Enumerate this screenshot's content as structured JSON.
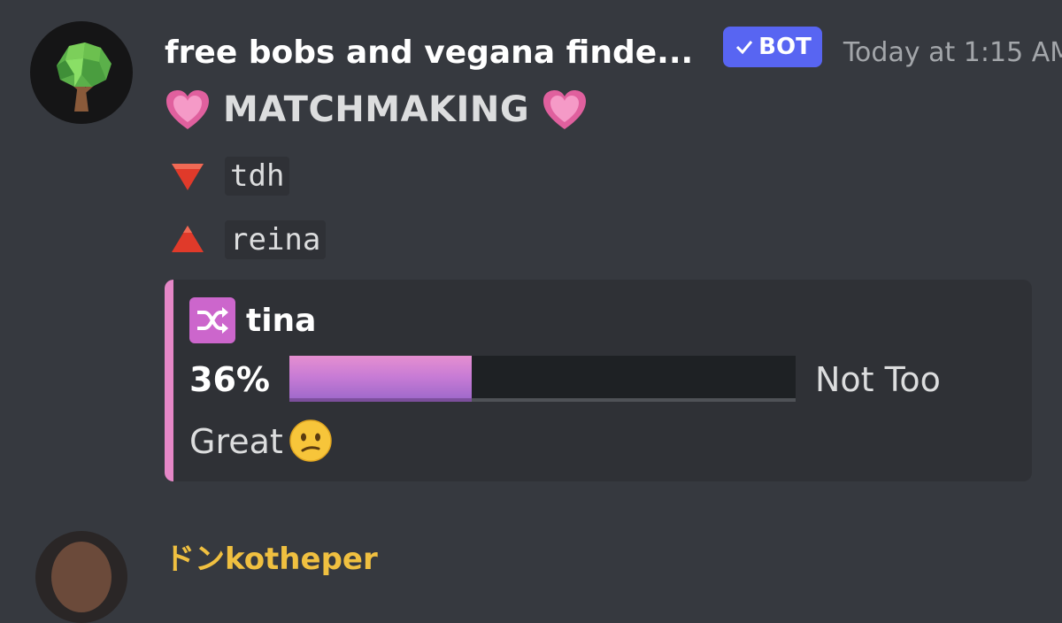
{
  "message": {
    "author": "free bobs and vegana finde...",
    "badge": "BOT",
    "timestamp": "Today at 1:15 AM",
    "title": "MATCHMAKING",
    "user_down": "tdh",
    "user_up": "reina"
  },
  "embed": {
    "accent_color": "#e587c7",
    "author": "tina",
    "author_icon": "shuffle-icon",
    "percent_label": "36%",
    "percent_value": 0.36,
    "verdict": "Not Too Great",
    "verdict_emoji": "confused-face-icon"
  },
  "next_message": {
    "author": "ドンkotheper"
  },
  "colors": {
    "background": "#36393f",
    "bot_badge": "#5865f2",
    "next_author": "#f0c040"
  }
}
